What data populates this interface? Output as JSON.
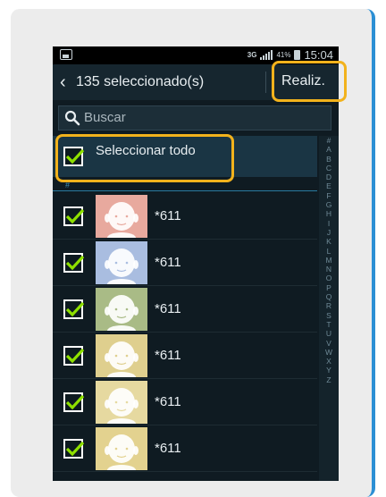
{
  "status_bar": {
    "network": "3G",
    "battery": "41%",
    "time": "15:04"
  },
  "header": {
    "title": "135 seleccionado(s)",
    "done_label": "Realiz."
  },
  "search": {
    "placeholder": "Buscar"
  },
  "select_all": {
    "label": "Seleccionar todo",
    "checked": true
  },
  "section_header": "#",
  "contacts": [
    {
      "name": "*611",
      "checked": true,
      "avatar_color": "#e8a99e"
    },
    {
      "name": "*611",
      "checked": true,
      "avatar_color": "#a9bde0"
    },
    {
      "name": "*611",
      "checked": true,
      "avatar_color": "#a9bb86"
    },
    {
      "name": "*611",
      "checked": true,
      "avatar_color": "#dfcf8e"
    },
    {
      "name": "*611",
      "checked": true,
      "avatar_color": "#e6d9a0"
    },
    {
      "name": "*611",
      "checked": true,
      "avatar_color": "#e3d28f"
    }
  ],
  "index_letters": [
    "#",
    "A",
    "B",
    "C",
    "D",
    "E",
    "F",
    "G",
    "H",
    "I",
    "J",
    "K",
    "L",
    "M",
    "N",
    "O",
    "P",
    "Q",
    "R",
    "S",
    "T",
    "U",
    "V",
    "W",
    "X",
    "Y",
    "Z"
  ],
  "colors": {
    "highlight": "#f2b21c",
    "check": "#8ee000",
    "accent_border": "#2c8fd4"
  }
}
